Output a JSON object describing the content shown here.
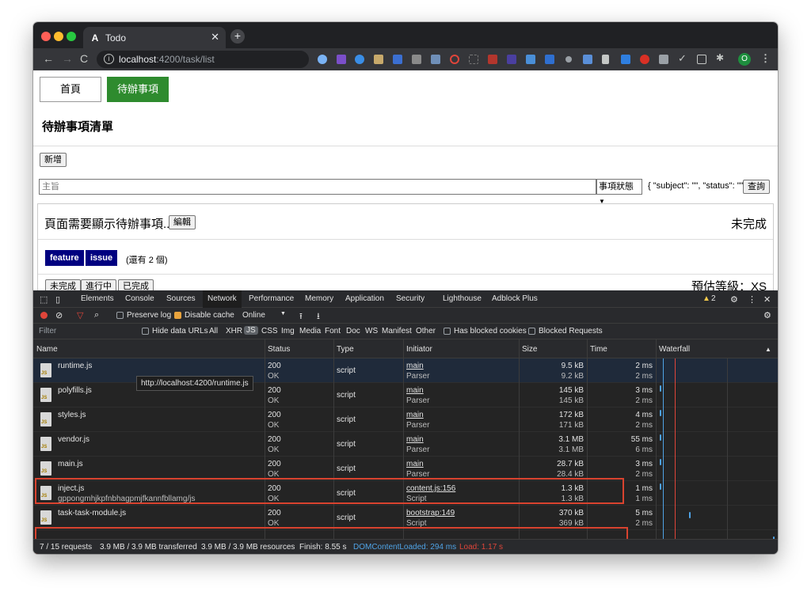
{
  "browser": {
    "tab_title": "Todo",
    "tab_favicon": "A",
    "url_host": "localhost",
    "url_path": ":4200/task/list",
    "profile_initial": "O"
  },
  "page": {
    "nav": [
      "首頁",
      "待辦事項"
    ],
    "heading": "待辦事項清單",
    "add_button": "新增",
    "subject_placeholder": "主旨",
    "status_select": "事項狀態",
    "query_json": "{ \"subject\": \"\", \"status\": \"\" }",
    "query_button": "查詢",
    "task": {
      "title": "頁面需要顯示待辦事項...",
      "edit_button": "編輯",
      "state": "未完成",
      "labels": [
        "feature",
        "issue"
      ],
      "remaining": "(還有 2 個)",
      "status_buttons": [
        "未完成",
        "進行中",
        "已完成"
      ],
      "estimate": "預估等級：XS"
    }
  },
  "devtools": {
    "tabs": [
      "Elements",
      "Console",
      "Sources",
      "Network",
      "Performance",
      "Memory",
      "Application",
      "Security",
      "Lighthouse",
      "Adblock Plus"
    ],
    "active_tab": "Network",
    "warnings": "2",
    "preserve_log": "Preserve log",
    "disable_cache": "Disable cache",
    "throttle": "Online",
    "filter_placeholder": "Filter",
    "hide_data_urls": "Hide data URLs",
    "types": [
      "All",
      "XHR",
      "JS",
      "CSS",
      "Img",
      "Media",
      "Font",
      "Doc",
      "WS",
      "Manifest",
      "Other"
    ],
    "active_type": "JS",
    "has_blocked_cookies": "Has blocked cookies",
    "blocked_requests": "Blocked Requests",
    "columns": [
      "Name",
      "Status",
      "Type",
      "Initiator",
      "Size",
      "Time",
      "Waterfall"
    ],
    "rows": [
      {
        "name": "runtime.js",
        "name2": "",
        "status": "200",
        "status2": "OK",
        "type": "script",
        "initiator": "main",
        "initiator2": "Parser",
        "size": "9.5 kB",
        "size2": "9.2 kB",
        "time": "2 ms",
        "time2": "2 ms"
      },
      {
        "name": "polyfills.js",
        "name2": "",
        "status": "200",
        "status2": "OK",
        "type": "script",
        "initiator": "main",
        "initiator2": "Parser",
        "size": "145 kB",
        "size2": "145 kB",
        "time": "3 ms",
        "time2": "2 ms"
      },
      {
        "name": "styles.js",
        "name2": "",
        "status": "200",
        "status2": "OK",
        "type": "script",
        "initiator": "main",
        "initiator2": "Parser",
        "size": "172 kB",
        "size2": "171 kB",
        "time": "4 ms",
        "time2": "2 ms"
      },
      {
        "name": "vendor.js",
        "name2": "",
        "status": "200",
        "status2": "OK",
        "type": "script",
        "initiator": "main",
        "initiator2": "Parser",
        "size": "3.1 MB",
        "size2": "3.1 MB",
        "time": "55 ms",
        "time2": "6 ms"
      },
      {
        "name": "main.js",
        "name2": "",
        "status": "200",
        "status2": "OK",
        "type": "script",
        "initiator": "main",
        "initiator2": "Parser",
        "size": "28.7 kB",
        "size2": "28.4 kB",
        "time": "3 ms",
        "time2": "2 ms"
      },
      {
        "name": "inject.js",
        "name2": "gppongmhjkpfnbhagpmjfkannfbllamg/js",
        "status": "200",
        "status2": "OK",
        "type": "script",
        "initiator": "content.js:156",
        "initiator2": "Script",
        "size": "1.3 kB",
        "size2": "1.3 kB",
        "time": "1 ms",
        "time2": "1 ms"
      },
      {
        "name": "task-task-module.js",
        "name2": "",
        "status": "200",
        "status2": "OK",
        "type": "script",
        "initiator": "bootstrap:149",
        "initiator2": "Script",
        "size": "370 kB",
        "size2": "369 kB",
        "time": "5 ms",
        "time2": "2 ms"
      }
    ],
    "tooltip": "http://localhost:4200/runtime.js",
    "summary": {
      "requests": "7 / 15 requests",
      "transferred": "3.9 MB / 3.9 MB transferred",
      "resources": "3.9 MB / 3.9 MB resources",
      "finish": "Finish: 8.55 s",
      "dcl": "DOMContentLoaded: 294 ms",
      "load": "Load: 1.17 s"
    }
  },
  "colors": {
    "active_nav": "#2e8b2e",
    "label_bg": "#000080",
    "highlight": "#d9432f",
    "dcl": "#4fa3e6"
  }
}
